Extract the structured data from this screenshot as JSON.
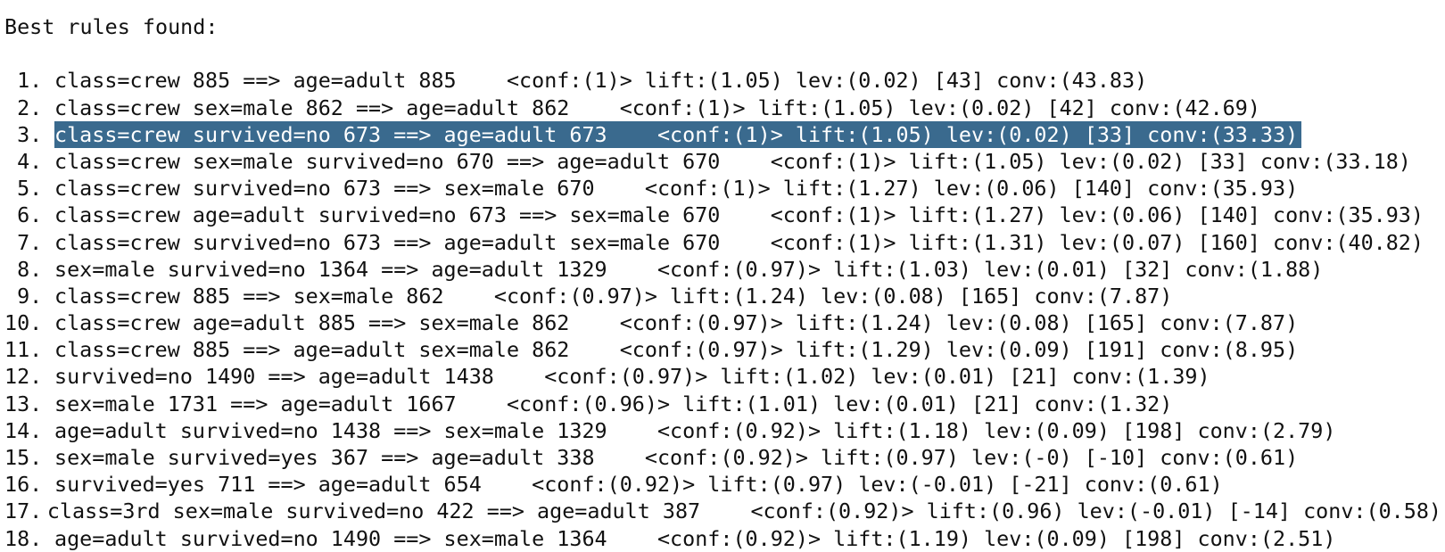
{
  "terminal": {
    "heading": "Best rules found:",
    "rules": [
      {
        "num": " 1.",
        "text": "class=crew 885 ==> age=adult 885    <conf:(1)> lift:(1.05) lev:(0.02) [43] conv:(43.83)"
      },
      {
        "num": " 2.",
        "text": "class=crew sex=male 862 ==> age=adult 862    <conf:(1)> lift:(1.05) lev:(0.02) [42] conv:(42.69)"
      },
      {
        "num": " 3.",
        "text": "class=crew survived=no 673 ==> age=adult 673    <conf:(1)> lift:(1.05) lev:(0.02) [33] conv:(33.33)"
      },
      {
        "num": " 4.",
        "text": "class=crew sex=male survived=no 670 ==> age=adult 670    <conf:(1)> lift:(1.05) lev:(0.02) [33] conv:(33.18)"
      },
      {
        "num": " 5.",
        "text": "class=crew survived=no 673 ==> sex=male 670    <conf:(1)> lift:(1.27) lev:(0.06) [140] conv:(35.93)"
      },
      {
        "num": " 6.",
        "text": "class=crew age=adult survived=no 673 ==> sex=male 670    <conf:(1)> lift:(1.27) lev:(0.06) [140] conv:(35.93)"
      },
      {
        "num": " 7.",
        "text": "class=crew survived=no 673 ==> age=adult sex=male 670    <conf:(1)> lift:(1.31) lev:(0.07) [160] conv:(40.82)"
      },
      {
        "num": " 8.",
        "text": "sex=male survived=no 1364 ==> age=adult 1329    <conf:(0.97)> lift:(1.03) lev:(0.01) [32] conv:(1.88)"
      },
      {
        "num": " 9.",
        "text": "class=crew 885 ==> sex=male 862    <conf:(0.97)> lift:(1.24) lev:(0.08) [165] conv:(7.87)"
      },
      {
        "num": "10.",
        "text": "class=crew age=adult 885 ==> sex=male 862    <conf:(0.97)> lift:(1.24) lev:(0.08) [165] conv:(7.87)"
      },
      {
        "num": "11.",
        "text": "class=crew 885 ==> age=adult sex=male 862    <conf:(0.97)> lift:(1.29) lev:(0.09) [191] conv:(8.95)"
      },
      {
        "num": "12.",
        "text": "survived=no 1490 ==> age=adult 1438    <conf:(0.97)> lift:(1.02) lev:(0.01) [21] conv:(1.39)"
      },
      {
        "num": "13.",
        "text": "sex=male 1731 ==> age=adult 1667    <conf:(0.96)> lift:(1.01) lev:(0.01) [21] conv:(1.32)"
      },
      {
        "num": "14.",
        "text": "age=adult survived=no 1438 ==> sex=male 1329    <conf:(0.92)> lift:(1.18) lev:(0.09) [198] conv:(2.79)"
      },
      {
        "num": "15.",
        "text": "sex=male survived=yes 367 ==> age=adult 338    <conf:(0.92)> lift:(0.97) lev:(-0) [-10] conv:(0.61)"
      },
      {
        "num": "16.",
        "text": "survived=yes 711 ==> age=adult 654    <conf:(0.92)> lift:(0.97) lev:(-0.01) [-21] conv:(0.61)"
      },
      {
        "num": "17.",
        "text": "class=3rd sex=male survived=no 422 ==> age=adult 387    <conf:(0.92)> lift:(0.96) lev:(-0.01) [-14] conv:(0.58)"
      },
      {
        "num": "18.",
        "text": "age=adult survived=no 1490 ==> sex=male 1364    <conf:(0.92)> lift:(1.19) lev:(0.09) [198] conv:(2.51)"
      }
    ],
    "selected_index": 2
  }
}
